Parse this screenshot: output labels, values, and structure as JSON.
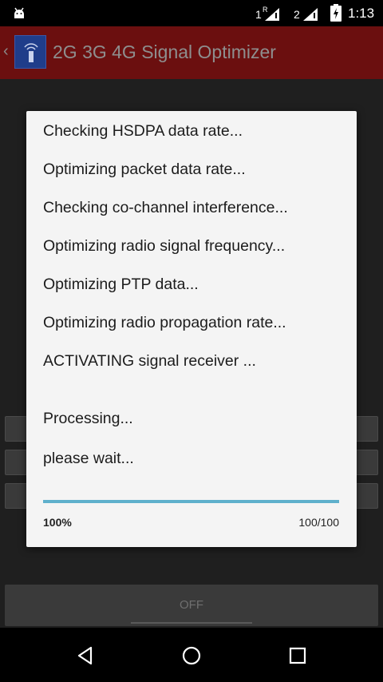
{
  "status_bar": {
    "time": "1:13",
    "sim1": "1",
    "sim1_flag": "R",
    "sim2": "2"
  },
  "app_bar": {
    "title": "2G 3G 4G Signal Optimizer"
  },
  "background": {
    "off_label": "OFF"
  },
  "dialog": {
    "messages": [
      "Checking HSDPA data rate...",
      "Optimizing packet data rate...",
      "Checking co-channel interference...",
      "Optimizing radio signal frequency...",
      "Optimizing PTP data...",
      "Optimizing radio propagation rate...",
      "ACTIVATING signal receiver ..."
    ],
    "processing": "Processing...",
    "wait": "please wait...",
    "progress_percent": "100%",
    "progress_count": "100/100",
    "progress_value": 1.0
  },
  "colors": {
    "app_bar": "#6b0f0f",
    "progress_fill": "#5fb0cc",
    "dialog_bg": "#f4f4f4"
  }
}
